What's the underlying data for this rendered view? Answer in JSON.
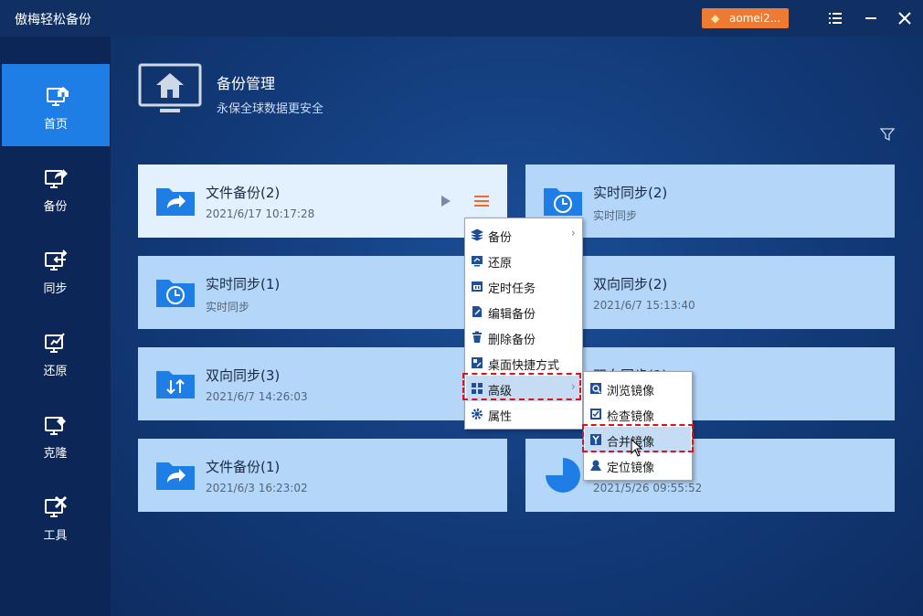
{
  "window": {
    "title": "傲梅轻松备份",
    "account": "aomei2...",
    "menu_icon": "list-icon",
    "close_icon": "close-icon"
  },
  "sidebar": {
    "items": [
      {
        "label": "首页",
        "icon": "home-monitor-icon",
        "active": true
      },
      {
        "label": "备份",
        "icon": "backup-monitor-icon"
      },
      {
        "label": "同步",
        "icon": "sync-monitor-icon"
      },
      {
        "label": "还原",
        "icon": "restore-monitor-icon"
      },
      {
        "label": "克隆",
        "icon": "clone-monitor-icon"
      },
      {
        "label": "工具",
        "icon": "tools-monitor-icon"
      }
    ]
  },
  "header": {
    "title": "备份管理",
    "subtitle": "永保全球数据更安全"
  },
  "cards": [
    {
      "title": "文件备份(2)",
      "subtitle": "2021/6/17 10:17:28",
      "icon": "folder-share-icon"
    },
    {
      "title": "实时同步(2)",
      "subtitle": "实时同步",
      "icon": "folder-clock-icon"
    },
    {
      "title": "实时同步(1)",
      "subtitle": "实时同步",
      "icon": "folder-clock-icon"
    },
    {
      "title": "双向同步(2)",
      "subtitle": "2021/6/7 15:13:40",
      "icon": "folder-sync-icon"
    },
    {
      "title": "双向同步(3)",
      "subtitle": "2021/6/7 14:26:03",
      "icon": "folder-sync-icon"
    },
    {
      "title": "双向同步(1)",
      "subtitle": "",
      "icon": "folder-sync-icon"
    },
    {
      "title": "文件备份(1)",
      "subtitle": "2021/6/3 16:23:02",
      "icon": "folder-share-icon"
    },
    {
      "title": "",
      "subtitle": "2021/5/26 09:55:52",
      "icon": "pie-chart-icon"
    }
  ],
  "context_menu": {
    "items": [
      {
        "label": "备份",
        "icon": "layers-icon",
        "submenu": true
      },
      {
        "label": "还原",
        "icon": "restore-icon"
      },
      {
        "label": "定时任务",
        "icon": "calendar-icon"
      },
      {
        "label": "编辑备份",
        "icon": "edit-icon"
      },
      {
        "label": "删除备份",
        "icon": "trash-icon"
      },
      {
        "label": "桌面快捷方式",
        "icon": "shortcut-icon"
      },
      {
        "label": "高级",
        "icon": "grid-icon",
        "submenu": true,
        "selected": true
      },
      {
        "label": "属性",
        "icon": "gear-icon"
      }
    ]
  },
  "submenu": {
    "items": [
      {
        "label": "浏览镜像",
        "icon": "browse-image-icon"
      },
      {
        "label": "检查镜像",
        "icon": "check-image-icon"
      },
      {
        "label": "合并镜像",
        "icon": "merge-image-icon",
        "selected": true
      },
      {
        "label": "定位镜像",
        "icon": "locate-image-icon"
      }
    ]
  }
}
